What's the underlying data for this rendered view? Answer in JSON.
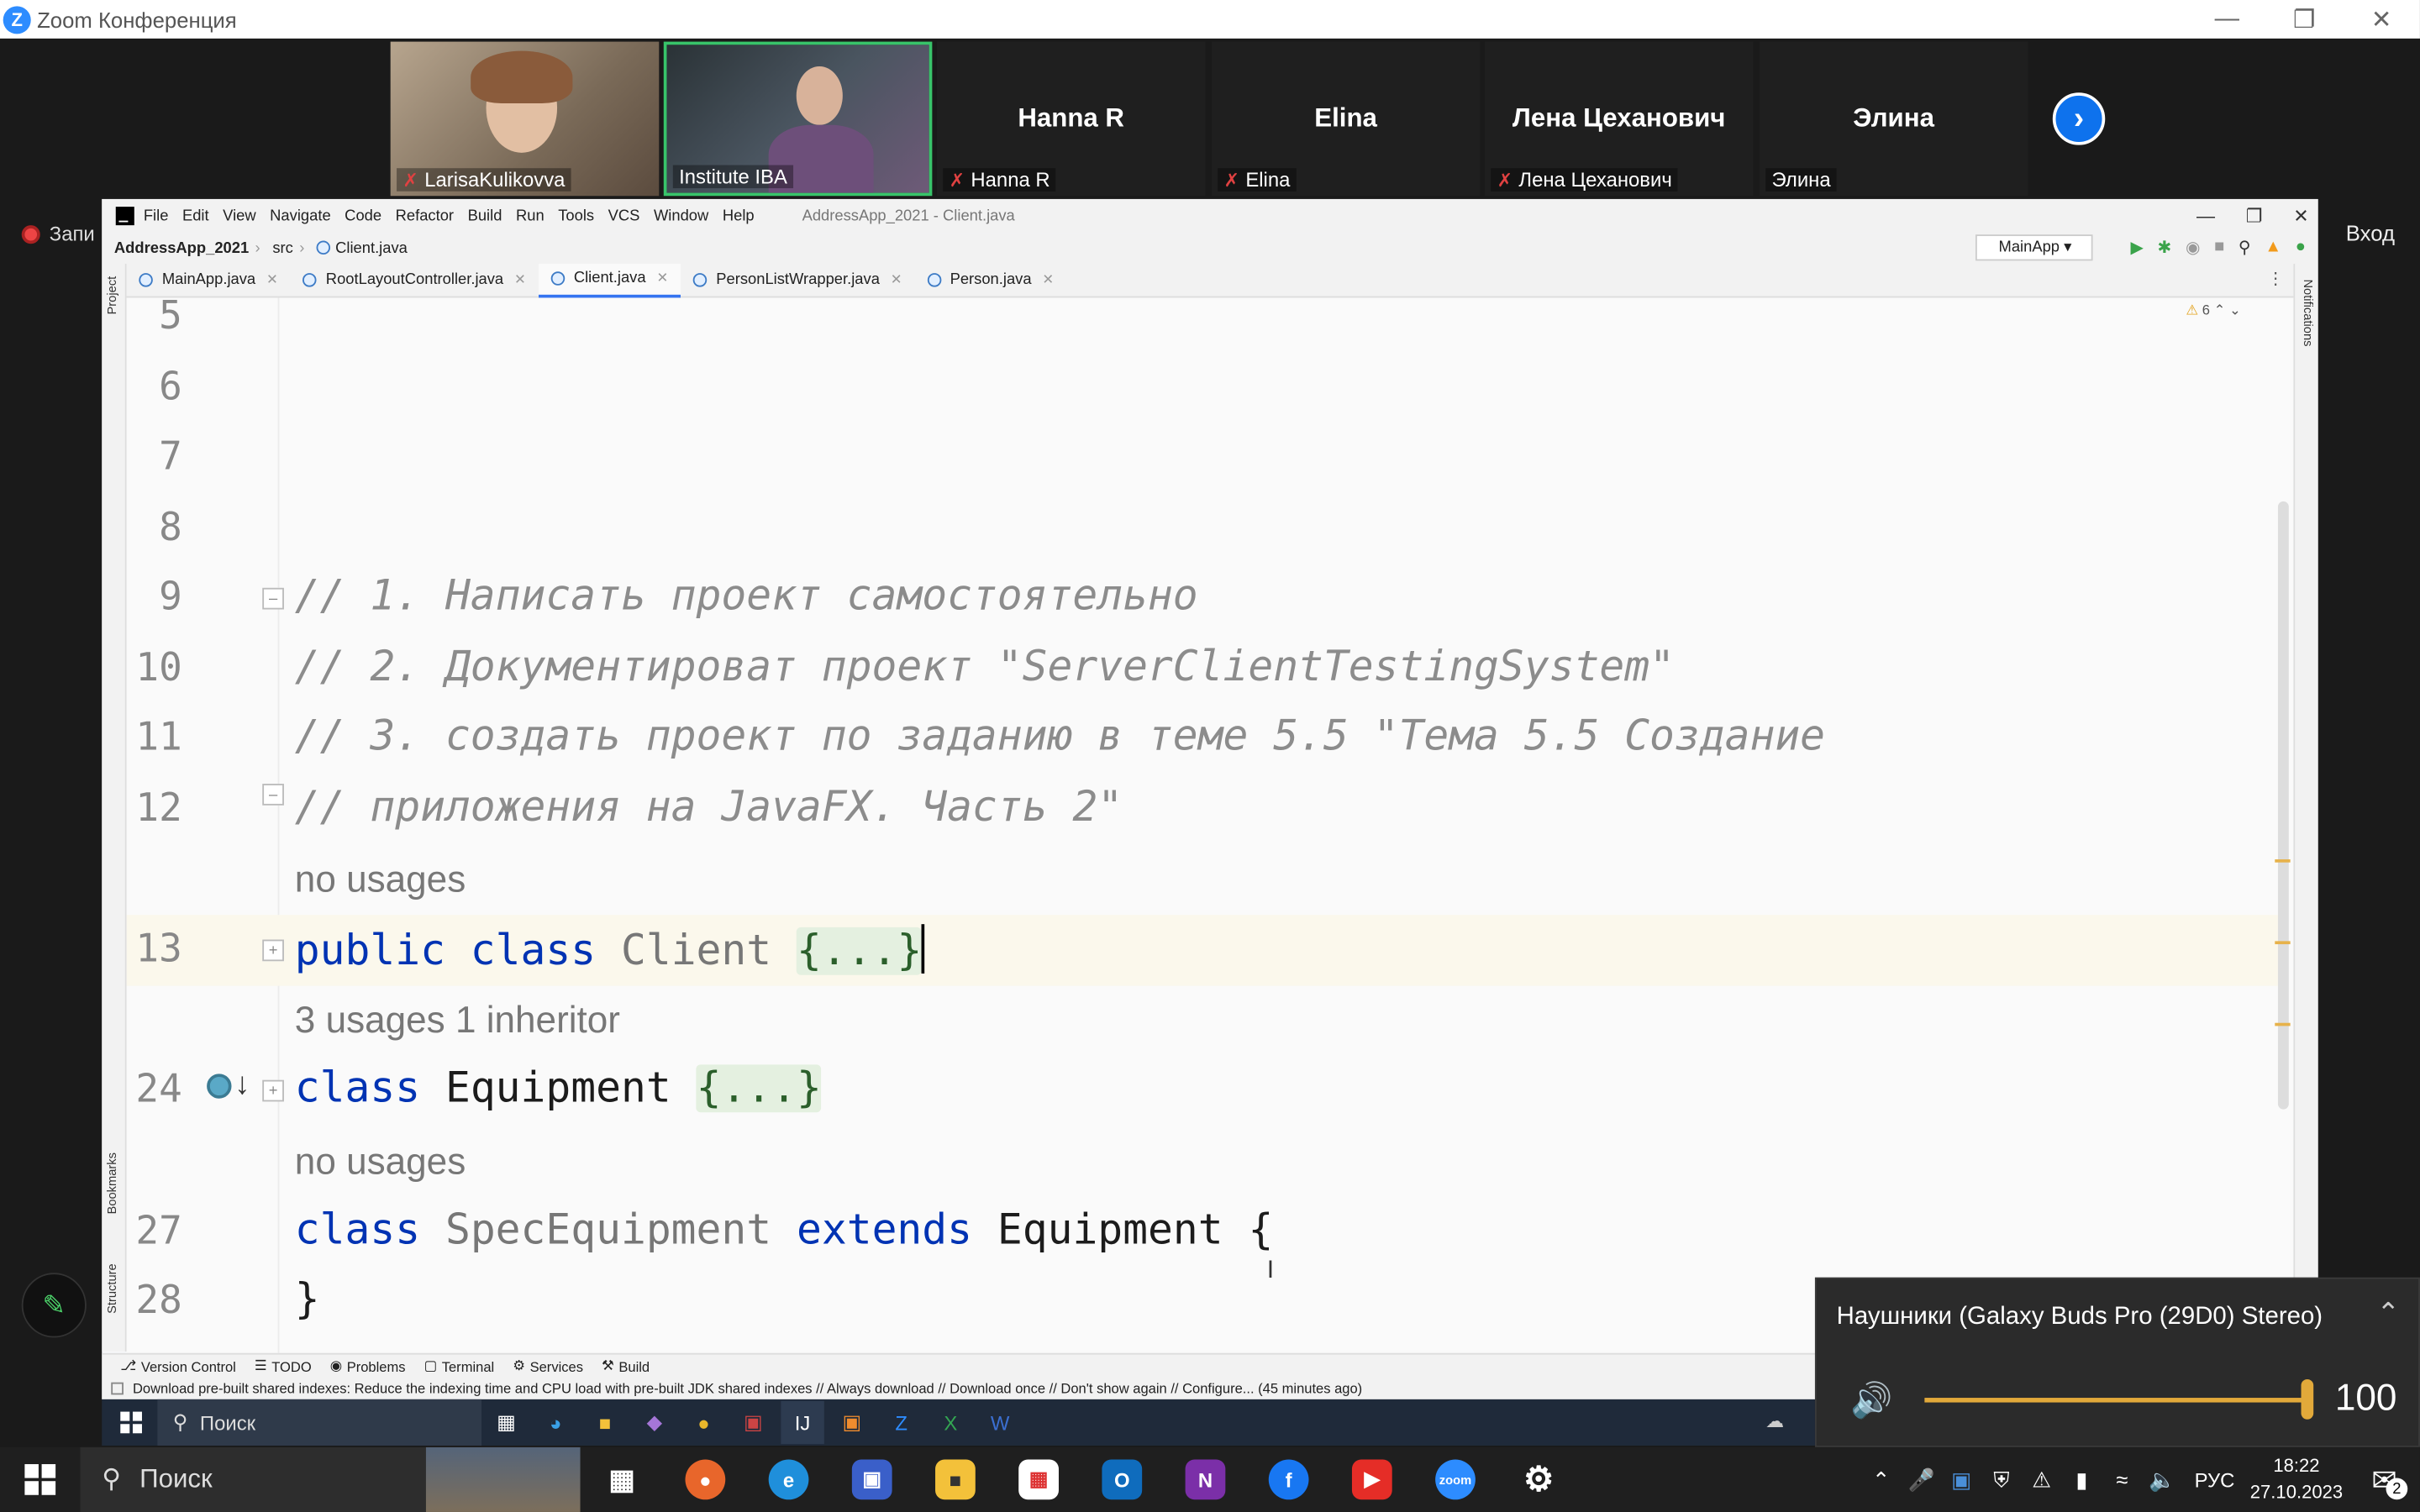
{
  "zoom": {
    "title": "Zoom Конференция",
    "recording_label": "Запи",
    "login_label": "Вход",
    "participants": [
      {
        "name": "LarisaKulikovva",
        "type": "video",
        "muted": true
      },
      {
        "name": "Institute IBA",
        "type": "video",
        "muted": false
      },
      {
        "name": "Hanna R",
        "type": "name",
        "muted": true
      },
      {
        "name": "Elina",
        "type": "name",
        "muted": true
      },
      {
        "name": "Лена Цеханович",
        "type": "name",
        "muted": true
      },
      {
        "name": "Элина",
        "type": "name",
        "muted": false
      }
    ]
  },
  "ide": {
    "menu": [
      "File",
      "Edit",
      "View",
      "Navigate",
      "Code",
      "Refactor",
      "Build",
      "Run",
      "Tools",
      "VCS",
      "Window",
      "Help"
    ],
    "window_title": "AddressApp_2021 - Client.java",
    "breadcrumb": {
      "project": "AddressApp_2021",
      "folder": "src",
      "file": "Client.java"
    },
    "run_config": "MainApp",
    "tabs": [
      {
        "label": "MainApp.java",
        "active": false
      },
      {
        "label": "RootLayoutController.java",
        "active": false
      },
      {
        "label": "Client.java",
        "active": true
      },
      {
        "label": "PersonListWrapper.java",
        "active": false
      },
      {
        "label": "Person.java",
        "active": false
      }
    ],
    "side_left": {
      "project": "Project",
      "bookmarks": "Bookmarks",
      "structure": "Structure"
    },
    "side_right": {
      "notifications": "Notifications"
    },
    "warnings": "6",
    "lines": {
      "l5": "5",
      "l6": "6",
      "l7": "7",
      "l8": "8",
      "l9": "9",
      "l10": "10",
      "l11": "11",
      "l12": "12",
      "l13": "13",
      "l24": "24",
      "l27": "27",
      "l28": "28"
    },
    "code": {
      "c9": "// 1. Написать проект самостоятельно",
      "c10": "// 2. Документироват проект \"ServerClientTestingSystem\"",
      "c11": "// 3. создать проект по заданию в теме 5.5 \"Тема 5.5 Создание",
      "c12": "// приложения на JavaFX. Часть 2\"",
      "hint13": "no usages",
      "c13_kw": "public class",
      "c13_name": "Client",
      "c13_fold": "{...}",
      "hint24": "3 usages   1 inheritor",
      "c24_kw": "class",
      "c24_name": "Equipment",
      "c24_fold": "{...}",
      "hint27": "no usages",
      "c27_kw": "class",
      "c27_name": "SpecEquipment",
      "c27_kw2": "extends",
      "c27_rest": "Equipment {",
      "c28": "}"
    },
    "bottom_tabs": [
      "Version Control",
      "TODO",
      "Problems",
      "Terminal",
      "Services",
      "Build"
    ],
    "status": "Download pre-built shared indexes: Reduce the indexing time and CPU load with pre-built JDK shared indexes // Always download // Download once // Don't show again // Configure... (45 minutes ago)"
  },
  "volume": {
    "device": "Наушники (Galaxy Buds Pro (29D0) Stereo)",
    "level": 100
  },
  "inner_taskbar": {
    "search": "Поиск"
  },
  "taskbar": {
    "search": "Поиск",
    "lang": "РУС",
    "time": "18:22",
    "date": "27.10.2023",
    "notifications": "2"
  }
}
